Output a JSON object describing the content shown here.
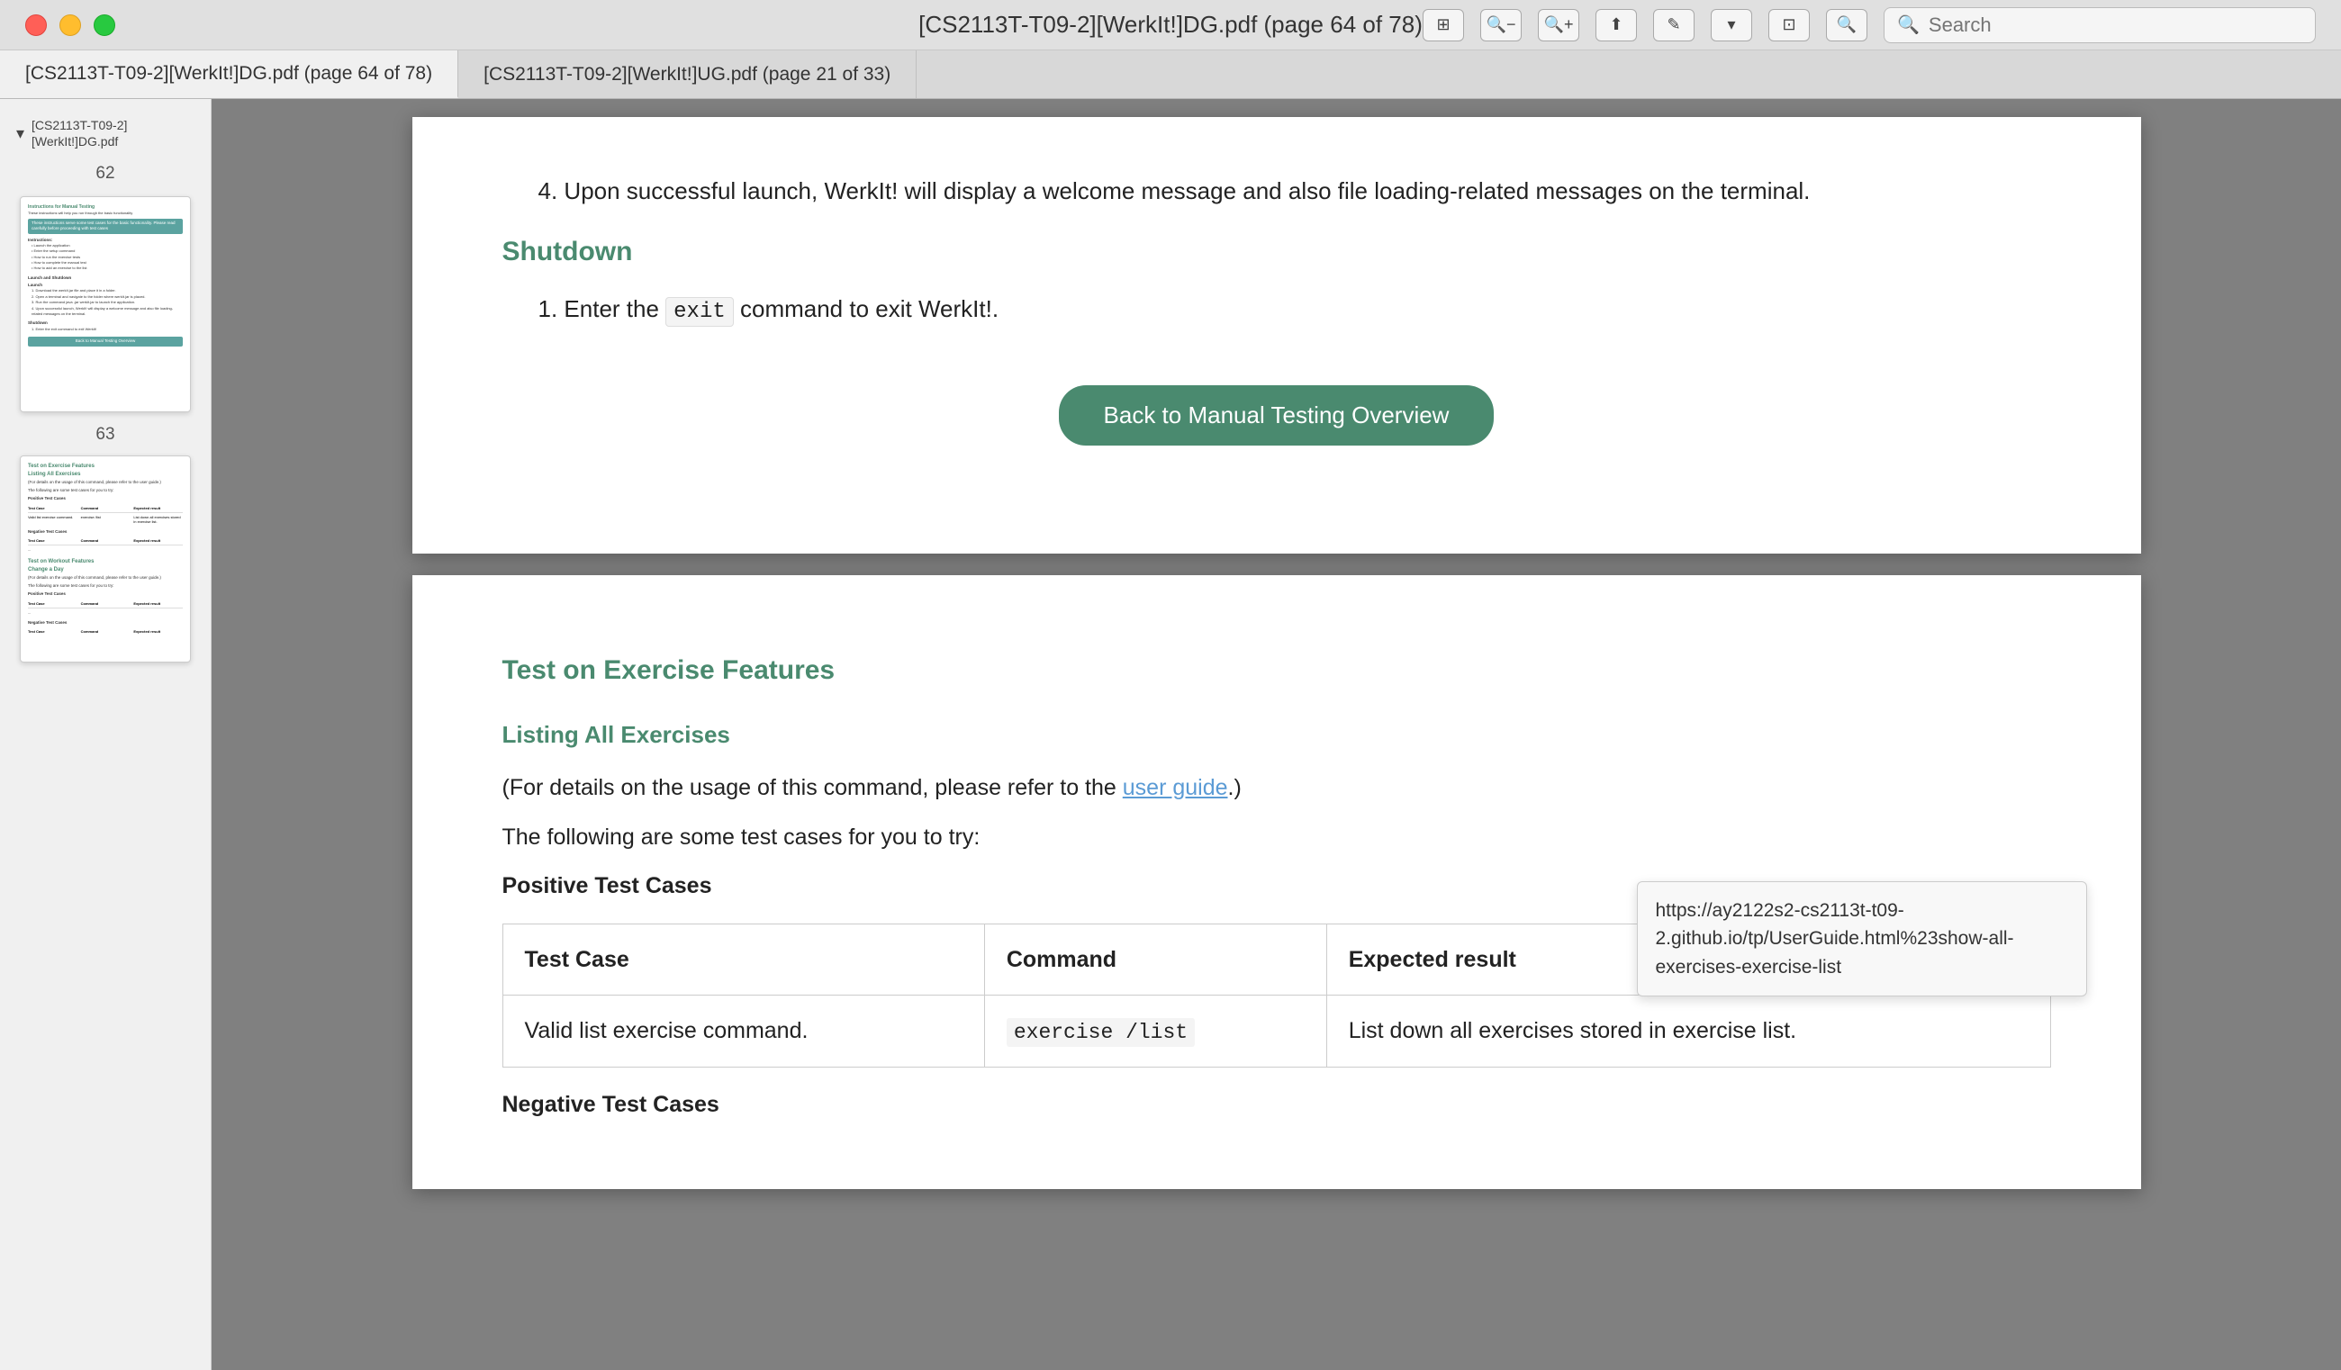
{
  "titlebar": {
    "title": "[CS2113T-T09-2][WerkIt!]DG.pdf (page 64 of 78)",
    "search_placeholder": "Search"
  },
  "tabs": [
    {
      "label": "[CS2113T-T09-2][WerkIt!]DG.pdf (page 64 of 78)",
      "active": true
    },
    {
      "label": "[CS2113T-T09-2][WerkIt!]UG.pdf (page 21 of 33)",
      "active": false
    }
  ],
  "sidebar": {
    "title": "[CS2113T-T09-2][WerkIt!]DG.pdf",
    "pages": [
      {
        "number": "62"
      },
      {
        "number": "63"
      }
    ]
  },
  "page1": {
    "step4": "Upon successful launch, WerkIt! will display a welcome message and also file loading-related messages on the terminal.",
    "shutdown_heading": "Shutdown",
    "step1_text": "Enter the ",
    "step1_code": "exit",
    "step1_suffix": " command to exit WerkIt!.",
    "back_button": "Back to Manual Testing Overview"
  },
  "page2": {
    "section_heading": "Test on Exercise Features",
    "sub_heading": "Listing All Exercises",
    "para1_prefix": "(For details on the usage of this command, please refer to the ",
    "para1_link": "user guide",
    "para1_suffix": ".)",
    "para2": "The following are some test cases for you to try:",
    "positive_heading": "Positive Test Cases",
    "table_headers": [
      "Test Case",
      "Command",
      "Expected result"
    ],
    "table_rows": [
      {
        "test_case": "Valid list exercise command.",
        "command": "exercise  /list",
        "expected": "List down all exercises stored in exercise list."
      }
    ],
    "negative_heading": "Negative Test Cases",
    "tooltip_url": "https://ay2122s2-cs2113t-t09-2.github.io/tp/UserGuide.html%23show-all-exercises-exercise-list"
  }
}
